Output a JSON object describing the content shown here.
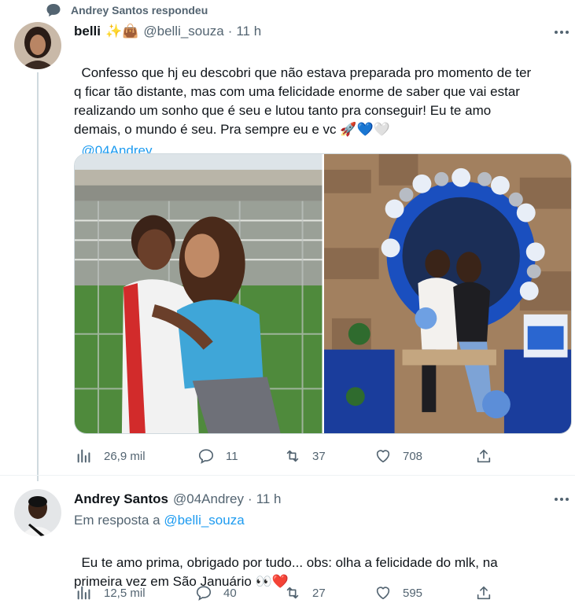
{
  "social_context": {
    "text": "Andrey Santos respondeu",
    "icon": "speech-bubble-icon"
  },
  "tweets": [
    {
      "name": "belli",
      "badges": "✨👜",
      "handle": "@belli_souza",
      "time": "11 h",
      "text": "Confesso que hj eu descobri que não estava preparada pro momento de ter\nq ficar tão distante, mas com uma felicidade enorme de saber que vai estar\nrealizando um sonho que é seu e lutou tanto pra conseguir! Eu te amo\ndemais, o mundo é seu. Pra sempre eu e vc 🚀💙🤍",
      "mention": "@04Andrey",
      "stats": {
        "views": "26,9 mil",
        "replies": "11",
        "retweets": "37",
        "likes": "708"
      }
    },
    {
      "name": "Andrey Santos",
      "handle": "@04Andrey",
      "time": "11 h",
      "reply_to_label": "Em resposta a",
      "reply_to_handle": "@belli_souza",
      "text": "Eu te amo prima, obrigado por tudo... obs: olha a felicidade do mlk, na\nprimeira vez em São Januário 👀❤️",
      "stats": {
        "views": "12,5 mil",
        "replies": "40",
        "retweets": "27",
        "likes": "595"
      }
    }
  ],
  "colors": {
    "accent": "#1d9bf0",
    "muted": "#536471",
    "text": "#0f1419"
  }
}
